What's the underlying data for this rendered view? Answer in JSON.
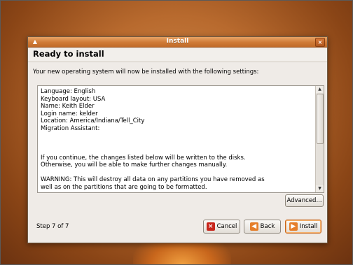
{
  "window": {
    "title": "Install",
    "close_label": "×"
  },
  "page": {
    "heading": "Ready to install",
    "intro": "Your new operating system will now be installed with the following settings:"
  },
  "summary": {
    "lines": [
      "Language: English",
      "Keyboard layout: USA",
      "Name: Keith Elder",
      "Login name: kelder",
      "Location: America/Indiana/Tell_City",
      "Migration Assistant:",
      "",
      "",
      "",
      "If you continue, the changes listed below will be written to the disks.",
      "Otherwise, you will be able to make further changes manually.",
      "",
      "WARNING: This will destroy all data on any partitions you have removed as",
      "well as on the partitions that are going to be formatted."
    ]
  },
  "buttons": {
    "advanced": "Advanced...",
    "cancel": "Cancel",
    "back": "Back",
    "install": "Install"
  },
  "step": "Step 7 of 7"
}
